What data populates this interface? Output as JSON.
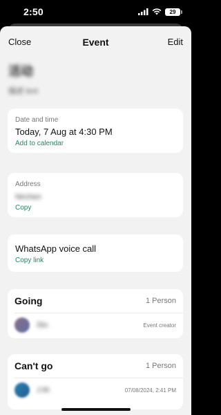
{
  "status_bar": {
    "time": "2:50",
    "battery": "29",
    "icons": [
      "signal-icon",
      "wifi-icon",
      "battery-icon"
    ]
  },
  "nav": {
    "close_label": "Close",
    "title": "Event",
    "edit_label": "Edit"
  },
  "event": {
    "name_obscured": "活动",
    "subtitle_obscured": "描述 text"
  },
  "date_card": {
    "label": "Date and time",
    "value": "Today, 7 Aug at 4:30 PM",
    "link": "Add to calendar"
  },
  "address_card": {
    "label": "Address",
    "value_obscured": "Nirchen",
    "link": "Copy"
  },
  "call_card": {
    "value": "WhatsApp voice call",
    "link": "Copy link"
  },
  "going": {
    "title": "Going",
    "count": "1 Person",
    "members": [
      {
        "name_obscured": "Stu",
        "meta": "Event creator"
      }
    ]
  },
  "cant_go": {
    "title": "Can't go",
    "count": "1 Person",
    "members": [
      {
        "name_obscured": "J.M.",
        "meta": "07/08/2024, 2:41 PM"
      }
    ]
  },
  "colors": {
    "accent": "#1f8a5b",
    "background": "#f2f2f2",
    "card": "#ffffff"
  }
}
